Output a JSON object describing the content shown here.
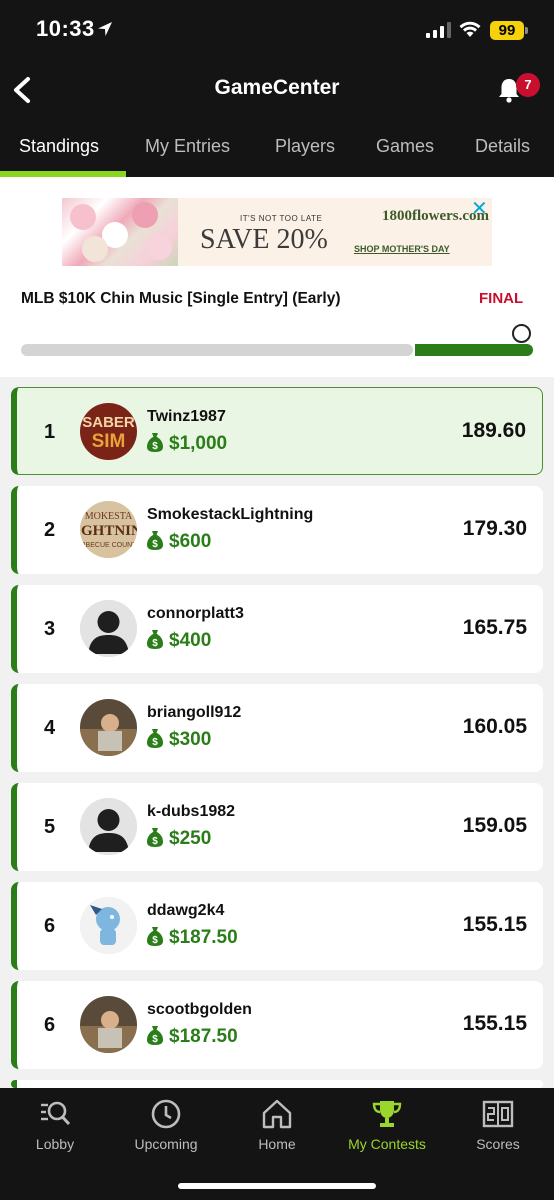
{
  "status_bar": {
    "time": "10:33",
    "battery": "99"
  },
  "header": {
    "title": "GameCenter",
    "notification_count": "7"
  },
  "tabs": [
    {
      "label": "Standings",
      "active": true
    },
    {
      "label": "My Entries",
      "active": false
    },
    {
      "label": "Players",
      "active": false
    },
    {
      "label": "Games",
      "active": false
    },
    {
      "label": "Details",
      "active": false
    }
  ],
  "ad": {
    "tagline": "IT'S NOT TOO LATE",
    "headline": "SAVE 20%",
    "brand": "1800flowers.com",
    "cta": "SHOP MOTHER'S DAY"
  },
  "contest": {
    "name": "MLB $10K Chin Music [Single Entry] (Early)",
    "status": "FINAL",
    "progress": 0.77
  },
  "standings": [
    {
      "rank": "1",
      "user": "Twinz1987",
      "prize": "$1,000",
      "score": "189.60",
      "avatar": "sabersim-logo"
    },
    {
      "rank": "2",
      "user": "SmokestackLightning",
      "prize": "$600",
      "score": "179.30",
      "avatar": "bbq-logo"
    },
    {
      "rank": "3",
      "user": "connorplatt3",
      "prize": "$400",
      "score": "165.75",
      "avatar": "default-person"
    },
    {
      "rank": "4",
      "user": "briangoll912",
      "prize": "$300",
      "score": "160.05",
      "avatar": "photo"
    },
    {
      "rank": "5",
      "user": "k-dubs1982",
      "prize": "$250",
      "score": "159.05",
      "avatar": "default-person"
    },
    {
      "rank": "6",
      "user": "ddawg2k4",
      "prize": "$187.50",
      "score": "155.15",
      "avatar": "cartoon"
    },
    {
      "rank": "6",
      "user": "scootbgolden",
      "prize": "$187.50",
      "score": "155.15",
      "avatar": "photo"
    }
  ],
  "bottom_nav": [
    {
      "label": "Lobby",
      "icon": "lobby-search-icon",
      "active": false
    },
    {
      "label": "Upcoming",
      "icon": "clock-icon",
      "active": false
    },
    {
      "label": "Home",
      "icon": "home-icon",
      "active": false
    },
    {
      "label": "My Contests",
      "icon": "trophy-icon",
      "active": true
    },
    {
      "label": "Scores",
      "icon": "scoreboard-icon",
      "active": false
    }
  ],
  "colors": {
    "accent": "#8ad51f",
    "money_green": "#2a7d18",
    "final_red": "#c8102e"
  }
}
